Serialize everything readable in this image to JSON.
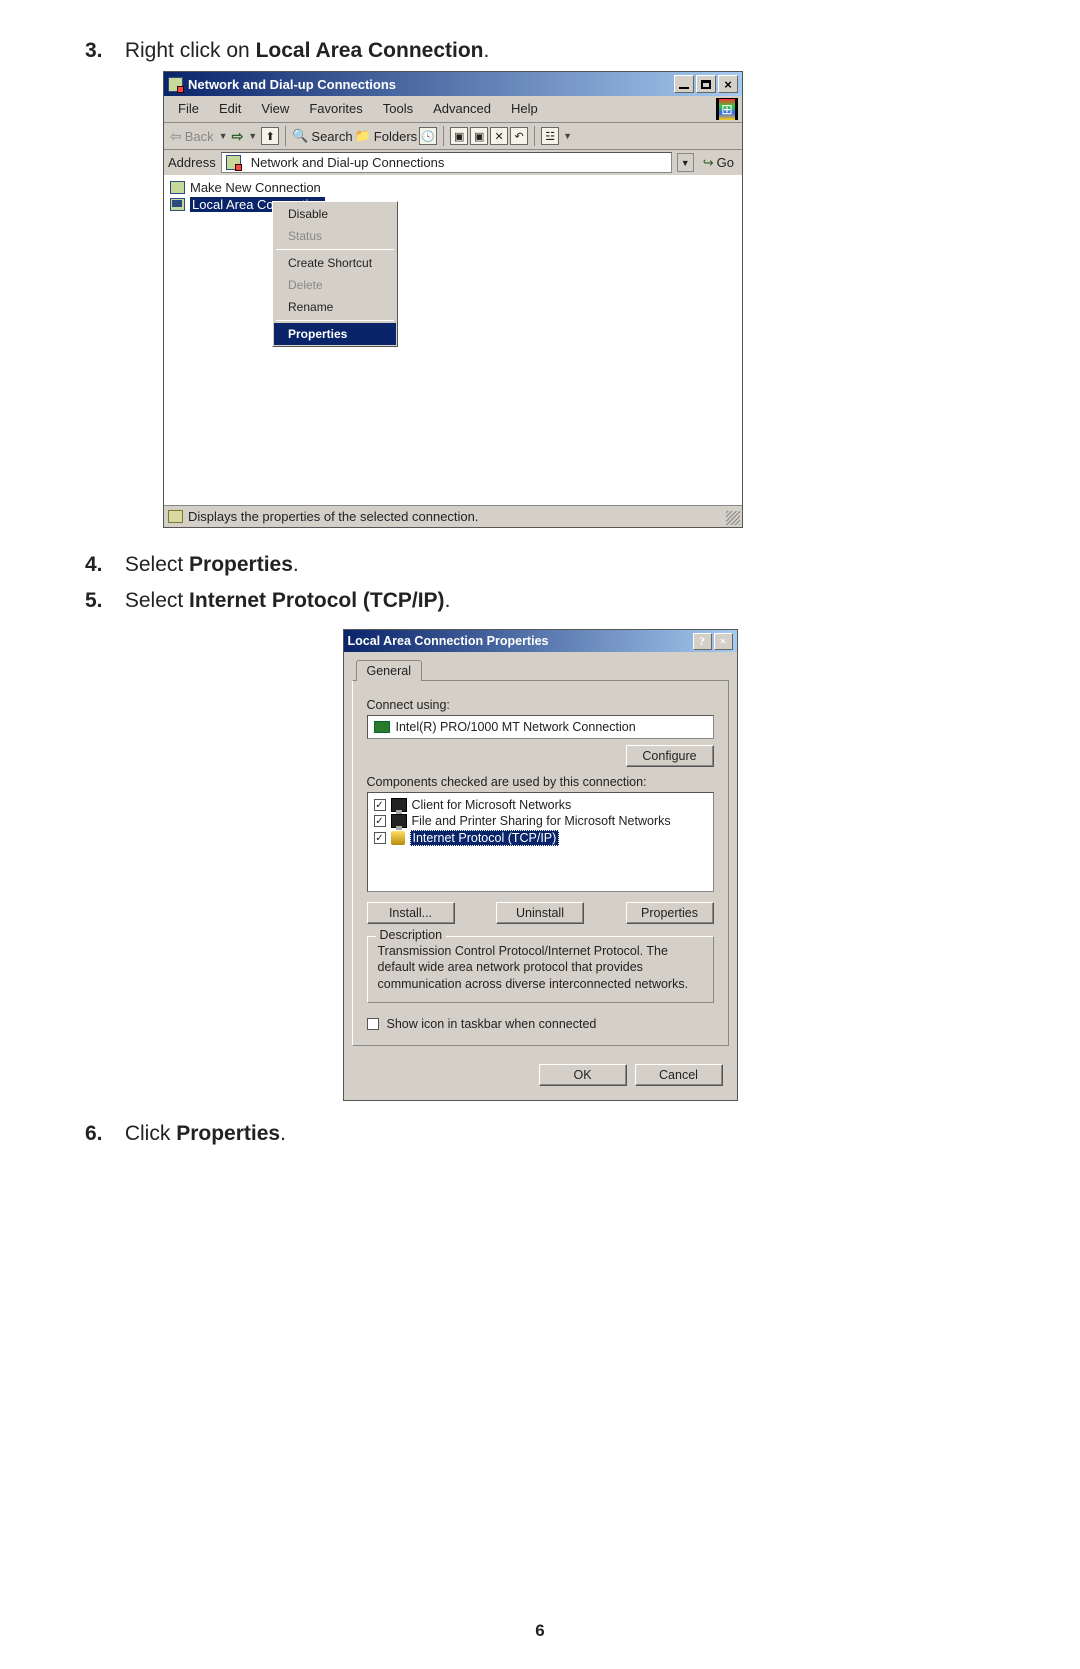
{
  "steps": {
    "s3": {
      "num": "3.",
      "pre": "Right click on ",
      "bold": "Local Area Connection",
      "post": "."
    },
    "s4": {
      "num": "4.",
      "pre": "Select ",
      "bold": "Properties",
      "post": "."
    },
    "s5": {
      "num": "5.",
      "pre": "Select ",
      "bold": "Internet Protocol (TCP/IP)",
      "post": "."
    },
    "s6": {
      "num": "6.",
      "pre": "Click ",
      "bold": "Properties",
      "post": "."
    }
  },
  "win1": {
    "title": "Network and Dial-up Connections",
    "menu": {
      "file": "File",
      "edit": "Edit",
      "view": "View",
      "favorites": "Favorites",
      "tools": "Tools",
      "advanced": "Advanced",
      "help": "Help"
    },
    "tb": {
      "back": "Back",
      "search": "Search",
      "folders": "Folders"
    },
    "addr": {
      "label": "Address",
      "value": "Network and Dial-up Connections",
      "go": "Go"
    },
    "items": {
      "mk": "Make New Connection",
      "lac": "Local Area Connection"
    },
    "ctx": {
      "disable": "Disable",
      "status": "Status",
      "shortcut": "Create Shortcut",
      "delete": "Delete",
      "rename": "Rename",
      "properties": "Properties"
    },
    "status": "Displays the properties of the selected connection."
  },
  "win2": {
    "title": "Local Area Connection Properties",
    "tab": "General",
    "connect_using": "Connect using:",
    "adapter": "Intel(R) PRO/1000 MT Network Connection",
    "configure": "Configure",
    "comp_label": "Components checked are used by this connection:",
    "comps": {
      "c1": "Client for Microsoft Networks",
      "c2": "File and Printer Sharing for Microsoft Networks",
      "c3": "Internet Protocol (TCP/IP)"
    },
    "btns": {
      "install": "Install...",
      "uninstall": "Uninstall",
      "properties": "Properties"
    },
    "desc_legend": "Description",
    "desc_text": "Transmission Control Protocol/Internet Protocol. The default wide area network protocol that provides communication across diverse interconnected networks.",
    "show_icon": "Show icon in taskbar when connected",
    "ok": "OK",
    "cancel": "Cancel"
  },
  "page_number": "6"
}
